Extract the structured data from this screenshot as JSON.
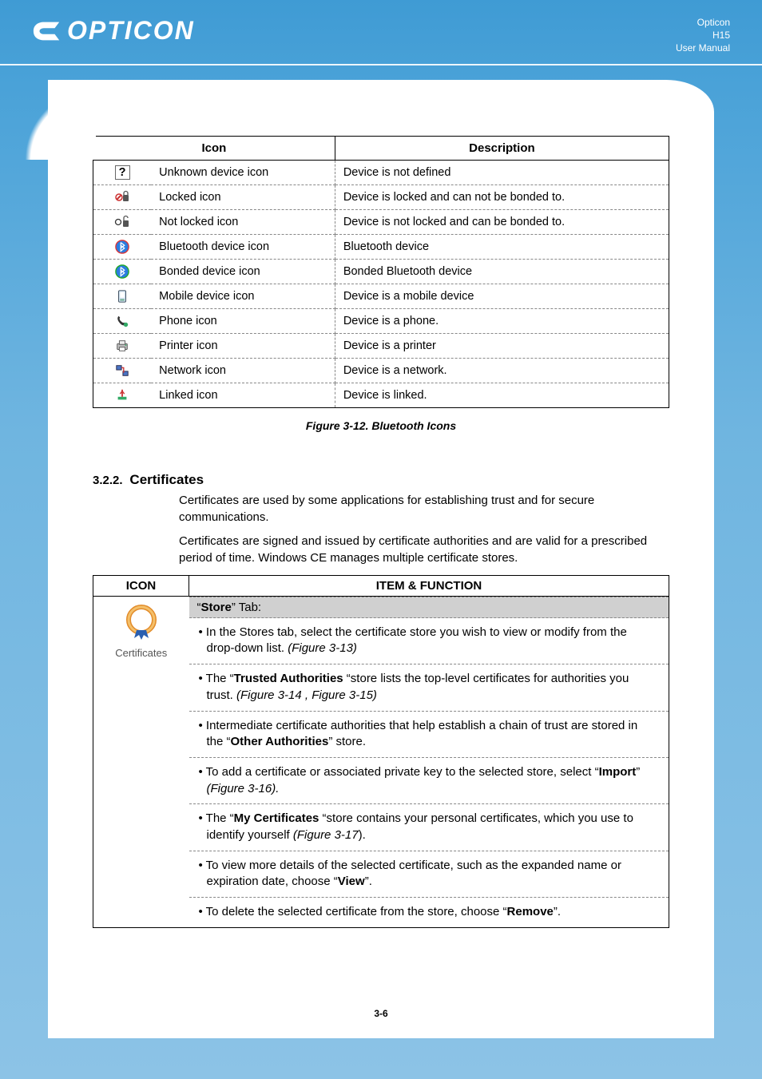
{
  "header": {
    "brand": "OPTICON",
    "right1": "Opticon",
    "right2": "H15",
    "right3": "User Manual"
  },
  "iconTable": {
    "head_icon": "Icon",
    "head_desc": "Description",
    "rows": [
      {
        "name": "Unknown device icon",
        "desc": "Device is not defined",
        "glyph": "?"
      },
      {
        "name": "Locked icon",
        "desc": "Device is locked and can not be bonded to.",
        "glyph": "locked"
      },
      {
        "name": "Not locked icon",
        "desc": "Device is not locked and can be bonded to.",
        "glyph": "unlocked"
      },
      {
        "name": "Bluetooth device icon",
        "desc": "Bluetooth device",
        "glyph": "bt"
      },
      {
        "name": "Bonded device icon",
        "desc": "Bonded Bluetooth device",
        "glyph": "bt2"
      },
      {
        "name": "Mobile device icon",
        "desc": "Device is a mobile device",
        "glyph": "pda"
      },
      {
        "name": "Phone icon",
        "desc": "Device is a phone.",
        "glyph": "phone"
      },
      {
        "name": "Printer icon",
        "desc": "Device is a printer",
        "glyph": "printer"
      },
      {
        "name": "Network icon",
        "desc": "Device is a network.",
        "glyph": "net"
      },
      {
        "name": "Linked icon",
        "desc": "Device is linked.",
        "glyph": "link"
      }
    ]
  },
  "figCaption": "Figure 3-12. Bluetooth Icons",
  "section": {
    "num": "3.2.2.",
    "title": "Certificates",
    "p1": "Certificates are used by some applications for establishing trust and for secure communications.",
    "p2": "Certificates are signed and issued by certificate authorities and are valid for a prescribed period of time. Windows CE manages multiple certificate stores."
  },
  "certTable": {
    "head_icon": "ICON",
    "head_func": "ITEM & FUNCTION",
    "iconLabel": "Certificates",
    "tabLabel_pre": "“",
    "tabLabel_bold": "Store",
    "tabLabel_post": "” Tab:",
    "bullets": [
      {
        "pre": "In the Stores tab, select the certificate store you wish to view or modify from the drop-down list. ",
        "ital": "(Figure 3-13)"
      },
      {
        "pre": "The “",
        "bold": "Trusted Authorities",
        "post": " “store lists the top-level certificates for authorities you trust. ",
        "ital": "(Figure 3-14 , Figure 3-15)"
      },
      {
        "pre": "Intermediate certificate authorities that help establish a chain of trust are stored in the “",
        "bold": "Other Authorities",
        "post": "” store."
      },
      {
        "pre": "To add a certificate or associated private key to the selected store, select “",
        "bold": "Import",
        "post": "” ",
        "ital": "(Figure 3-16)."
      },
      {
        "pre": "The “",
        "bold": "My Certificates",
        "post": " “store contains your personal certificates, which you use to identify yourself ",
        "ital": "(Figure 3-17",
        "post2": ")."
      },
      {
        "pre": "To view more details of the selected certificate, such as the expanded name or expiration date, choose “",
        "bold": "View",
        "post": "”."
      },
      {
        "pre": "To delete the selected certificate from the store, choose “",
        "bold": "Remove",
        "post": "”."
      }
    ]
  },
  "pageNum": "3-6"
}
